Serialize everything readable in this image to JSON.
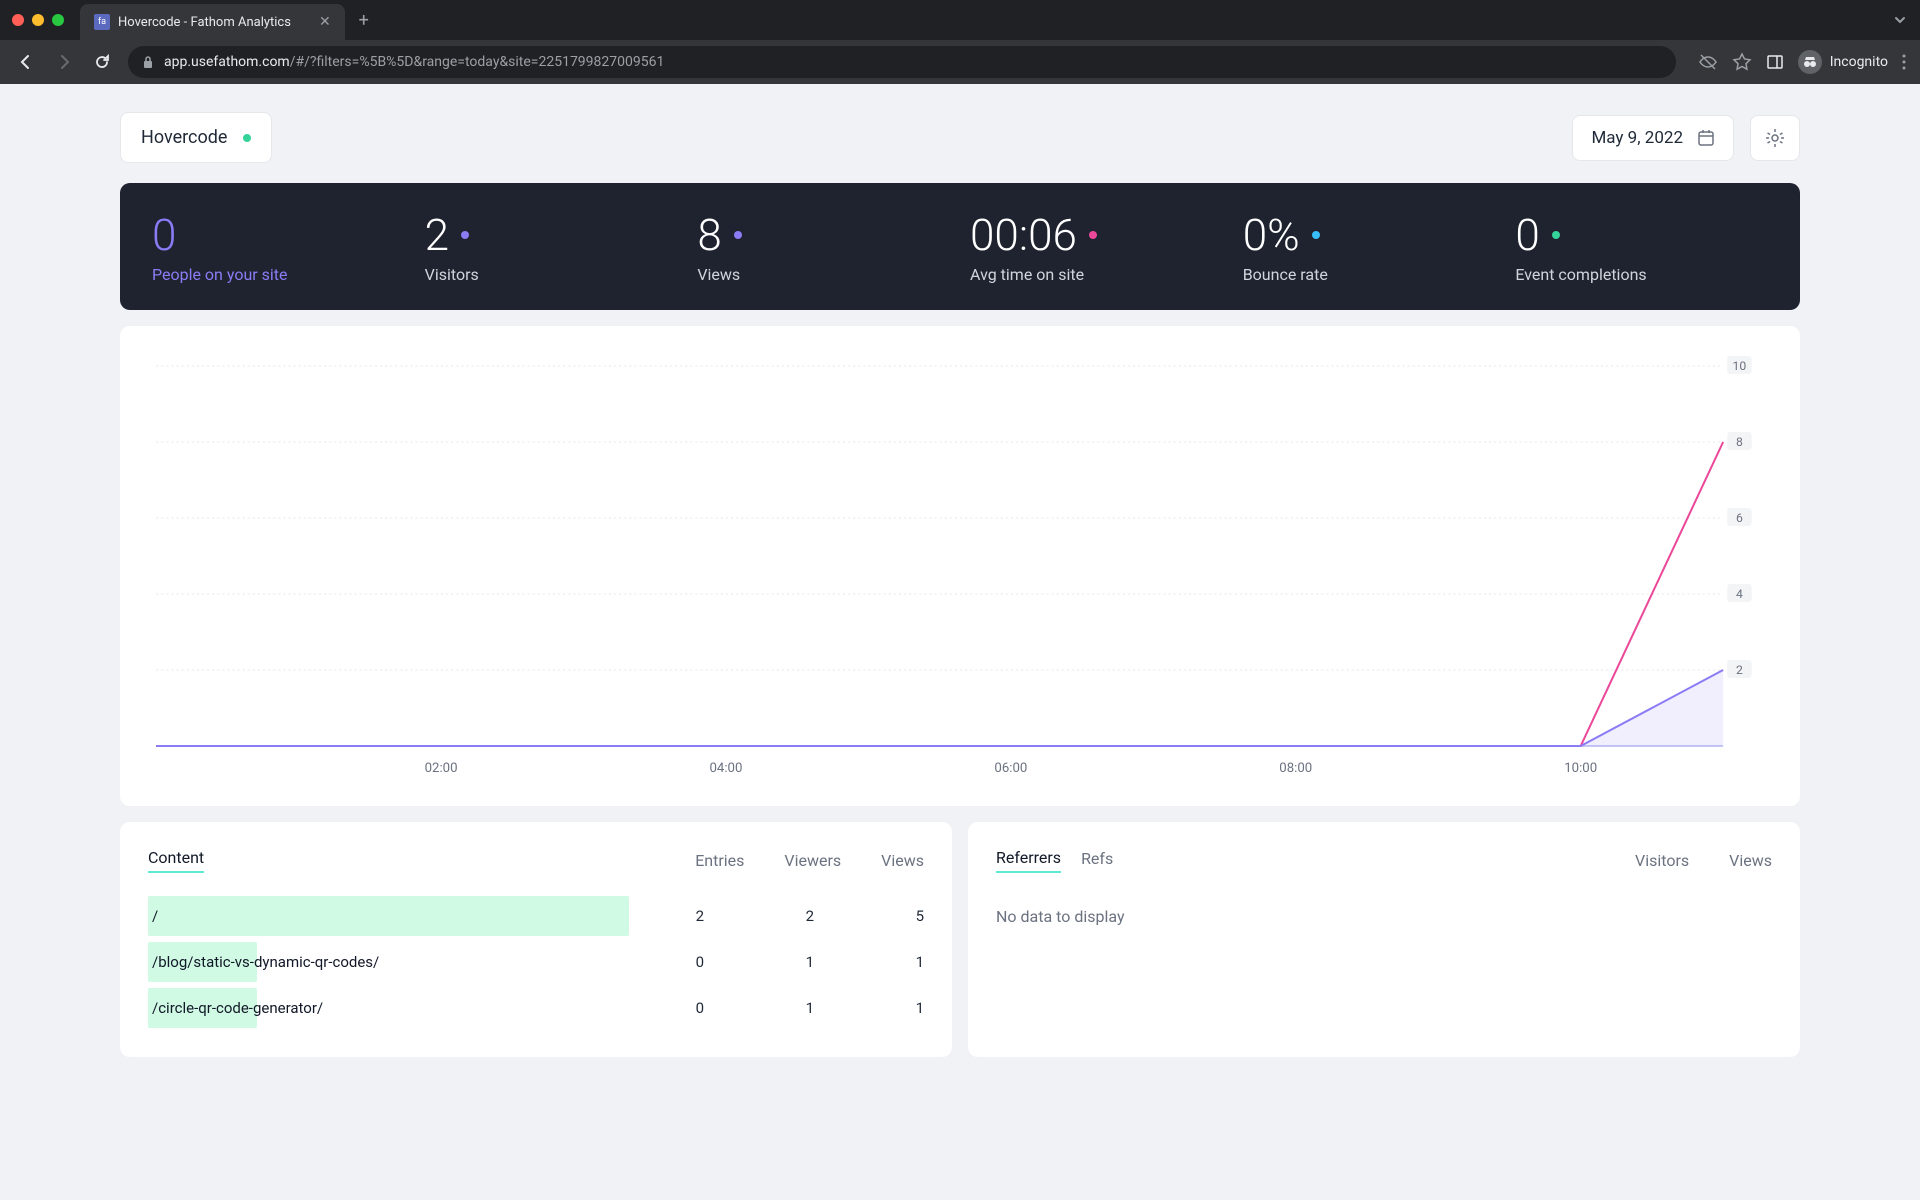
{
  "browser": {
    "tab_title": "Hovercode - Fathom Analytics",
    "url_domain": "app.usefathom.com",
    "url_path": "/#/?filters=%5B%5D&range=today&site=2251799827009561",
    "incognito_label": "Incognito"
  },
  "header": {
    "site_name": "Hovercode",
    "date_label": "May 9, 2022"
  },
  "metrics": [
    {
      "value": "0",
      "label": "People on your site",
      "accent": "purple",
      "dot": null
    },
    {
      "value": "2",
      "label": "Visitors",
      "dot": "purple"
    },
    {
      "value": "8",
      "label": "Views",
      "dot": "purple"
    },
    {
      "value": "00:06",
      "label": "Avg time on site",
      "dot": "pink"
    },
    {
      "value": "0%",
      "label": "Bounce rate",
      "dot": "blue"
    },
    {
      "value": "0",
      "label": "Event completions",
      "dot": "green"
    }
  ],
  "chart_data": {
    "type": "line",
    "x_labels": [
      "02:00",
      "04:00",
      "06:00",
      "08:00",
      "10:00"
    ],
    "y_ticks": [
      2,
      4,
      6,
      8,
      10
    ],
    "ylim": [
      0,
      10
    ],
    "series": [
      {
        "name": "Views",
        "color": "#ec4899",
        "values": [
          0,
          0,
          0,
          0,
          0,
          0,
          0,
          0,
          0,
          0,
          0,
          8
        ],
        "area": false
      },
      {
        "name": "Visitors",
        "color": "#8b7cf6",
        "values": [
          0,
          0,
          0,
          0,
          0,
          0,
          0,
          0,
          0,
          0,
          0,
          2
        ],
        "area": true
      }
    ],
    "x_hours": [
      0,
      1,
      2,
      3,
      4,
      5,
      6,
      7,
      8,
      9,
      10,
      11
    ]
  },
  "content_table": {
    "tabs": [
      "Content"
    ],
    "columns": [
      "Entries",
      "Viewers",
      "Views"
    ],
    "rows": [
      {
        "path": "/",
        "entries": 2,
        "viewers": 2,
        "views": 5,
        "bar_pct": 62
      },
      {
        "path": "/blog/static-vs-dynamic-qr-codes/",
        "entries": 0,
        "viewers": 1,
        "views": 1,
        "bar_pct": 14
      },
      {
        "path": "/circle-qr-code-generator/",
        "entries": 0,
        "viewers": 1,
        "views": 1,
        "bar_pct": 14
      }
    ]
  },
  "referrers_table": {
    "tabs": [
      "Referrers",
      "Refs"
    ],
    "columns": [
      "Visitors",
      "Views"
    ],
    "no_data": "No data to display"
  }
}
